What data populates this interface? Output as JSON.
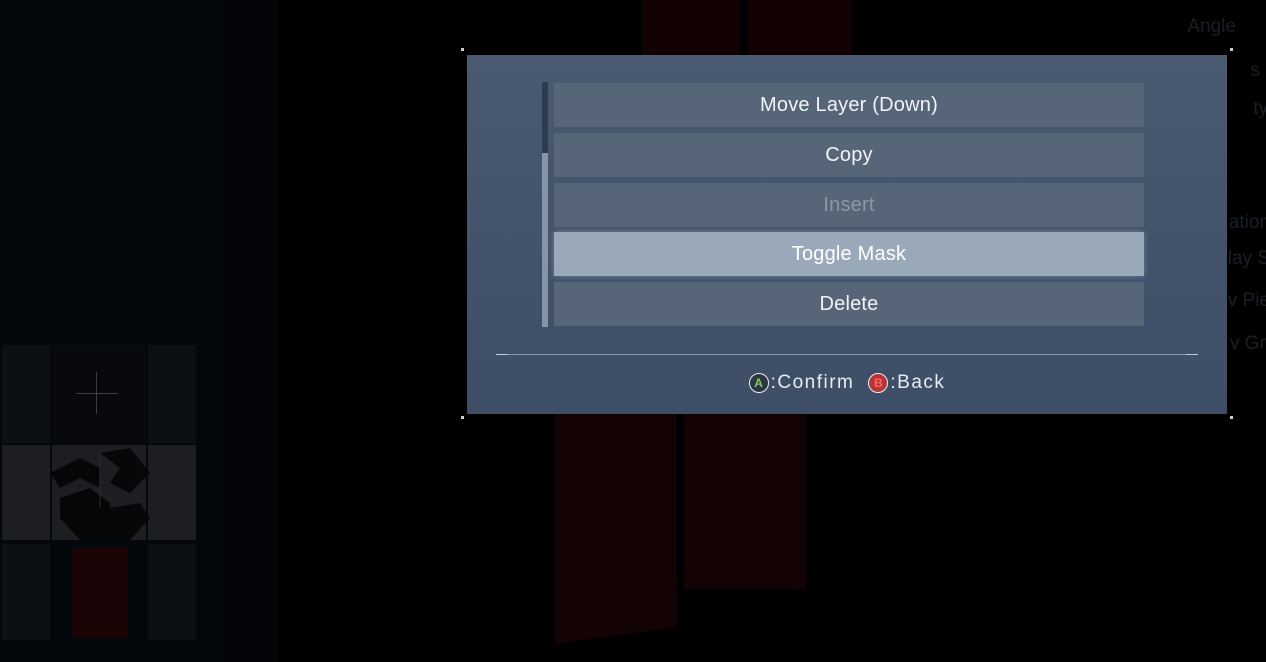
{
  "dialog": {
    "menu_items": [
      {
        "label": "Move Layer (Down)",
        "state": "normal"
      },
      {
        "label": "Copy",
        "state": "normal"
      },
      {
        "label": "Insert",
        "state": "disabled"
      },
      {
        "label": "Toggle Mask",
        "state": "selected"
      },
      {
        "label": "Delete",
        "state": "normal"
      }
    ],
    "hints": {
      "confirm_button": "A",
      "confirm_label": ":Confirm",
      "back_button": "B",
      "back_label": ":Back"
    }
  },
  "background": {
    "right_panel_fragments": [
      "Angle",
      "s",
      "ty",
      "ation",
      "splay S",
      "v Pie",
      "v Gri"
    ]
  },
  "colors": {
    "dialog_bg": "#46566d",
    "item_bg": "#566577",
    "selected_bg": "#9aa9ba",
    "button_a": "#7fcf5f",
    "button_b": "#b7353a"
  }
}
